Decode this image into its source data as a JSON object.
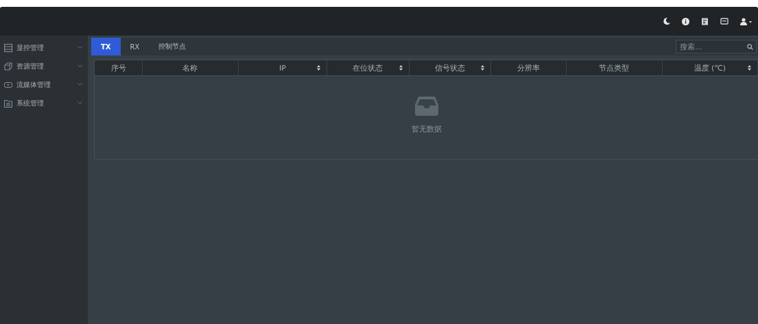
{
  "sidebar": {
    "items": [
      {
        "label": "显控管理",
        "expanded": false
      },
      {
        "label": "资源管理",
        "expanded": false
      },
      {
        "label": "流媒体管理",
        "expanded": false
      },
      {
        "label": "系统管理",
        "expanded": false
      }
    ]
  },
  "tabs": [
    {
      "label": "TX",
      "selected": true
    },
    {
      "label": "RX",
      "selected": false
    },
    {
      "label": "控制节点",
      "selected": false
    }
  ],
  "search": {
    "placeholder": "搜索..."
  },
  "table": {
    "columns": [
      {
        "label": "序号",
        "sortable": false
      },
      {
        "label": "名称",
        "sortable": false
      },
      {
        "label": "IP",
        "sortable": true
      },
      {
        "label": "在位状态",
        "sortable": true
      },
      {
        "label": "信号状态",
        "sortable": true
      },
      {
        "label": "分辨率",
        "sortable": false
      },
      {
        "label": "节点类型",
        "sortable": false
      },
      {
        "label": "温度 (℃)",
        "sortable": true
      }
    ],
    "empty_text": "暂无数据"
  }
}
